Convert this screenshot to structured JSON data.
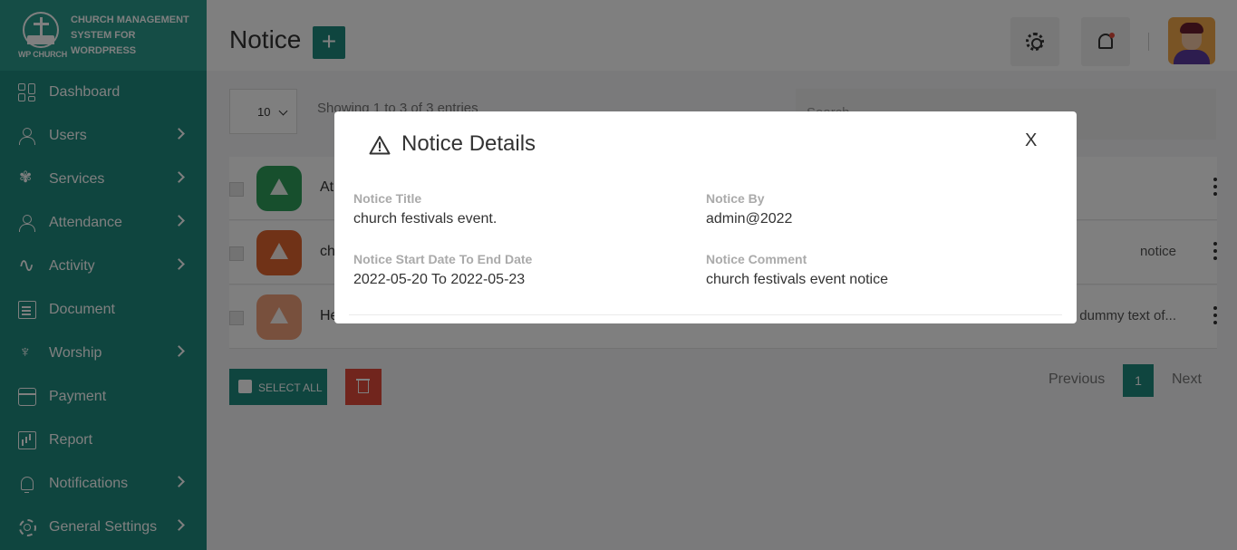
{
  "brand": {
    "mark_text": "WP CHURCH",
    "line1": "CHURCH MANAGEMENT",
    "line2": "SYSTEM FOR",
    "line3": "WORDPRESS"
  },
  "sidebar": {
    "items": [
      {
        "label": "Dashboard",
        "icon": "dashboard-icon",
        "has_submenu": false
      },
      {
        "label": "Users",
        "icon": "user-icon",
        "has_submenu": true
      },
      {
        "label": "Services",
        "icon": "services-icon",
        "has_submenu": true
      },
      {
        "label": "Attendance",
        "icon": "attendance-icon",
        "has_submenu": true
      },
      {
        "label": "Activity",
        "icon": "activity-icon",
        "has_submenu": true
      },
      {
        "label": "Document",
        "icon": "document-icon",
        "has_submenu": false
      },
      {
        "label": "Worship",
        "icon": "worship-icon",
        "has_submenu": true
      },
      {
        "label": "Payment",
        "icon": "payment-icon",
        "has_submenu": false
      },
      {
        "label": "Report",
        "icon": "report-icon",
        "has_submenu": false
      },
      {
        "label": "Notifications",
        "icon": "bell-icon",
        "has_submenu": true
      },
      {
        "label": "General Settings",
        "icon": "gear-icon",
        "has_submenu": true
      }
    ]
  },
  "header": {
    "title": "Notice",
    "add_label": "+"
  },
  "table": {
    "page_length": "10",
    "info": "Showing 1 to 3 of 3 entries",
    "search_placeholder": "Search...",
    "rows": [
      {
        "text": "At",
        "right_text": "",
        "badge_color": "#2e9e5b"
      },
      {
        "text": "ch",
        "right_text": "notice",
        "badge_color": "#e0652e"
      },
      {
        "text": "He",
        "right_text": "dummy text of...",
        "badge_color": "#f0a17a"
      }
    ],
    "select_all_label": "SELECT ALL",
    "pagination": {
      "previous": "Previous",
      "current": "1",
      "next": "Next"
    }
  },
  "modal": {
    "title": "Notice Details",
    "close_label": "X",
    "fields": {
      "title_label": "Notice Title",
      "title_value": "church festivals event.",
      "by_label": "Notice By",
      "by_value": "admin@2022",
      "dates_label": "Notice Start Date To End Date",
      "dates_value": "2022-05-20 To 2022-05-23",
      "comment_label": "Notice Comment",
      "comment_value": "church festivals event notice"
    }
  },
  "colors": {
    "primary": "#1f8a7e",
    "danger": "#e24a3b"
  }
}
